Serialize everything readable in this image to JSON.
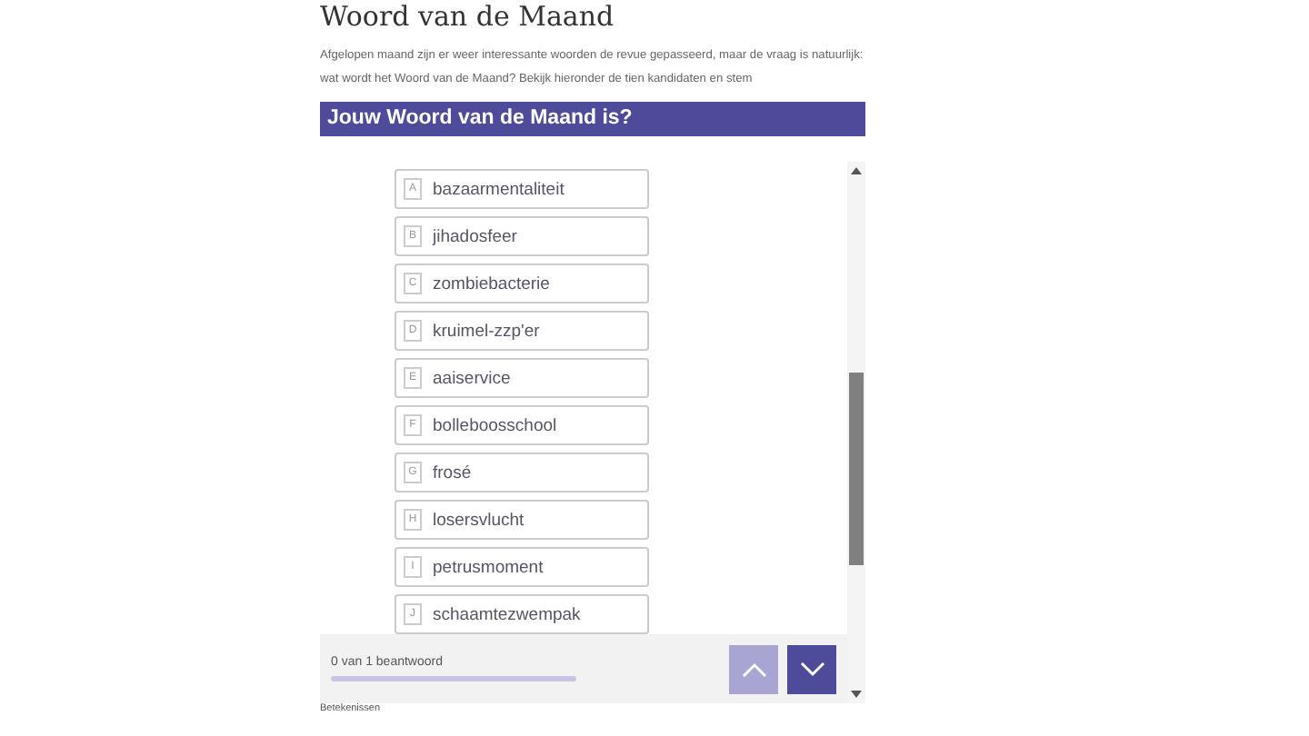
{
  "page": {
    "title": "Woord van de Maand",
    "intro": "Afgelopen maand zijn er weer interessante woorden de revue gepasseerd, maar de vraag is natuurlijk: wat wordt het Woord van de Maand? Bekijk hieronder de tien kandidaten en stem"
  },
  "survey": {
    "question": "Jouw Woord van de Maand is?",
    "options": [
      {
        "key": "A",
        "label": "bazaarmentaliteit",
        "selected": false
      },
      {
        "key": "B",
        "label": "jihadosfeer",
        "selected": false
      },
      {
        "key": "C",
        "label": "zombiebacterie",
        "selected": false
      },
      {
        "key": "D",
        "label": "kruimel-zzp'er",
        "selected": false
      },
      {
        "key": "E",
        "label": "aaiservice",
        "selected": false
      },
      {
        "key": "F",
        "label": "bolleboosschool",
        "selected": false
      },
      {
        "key": "G",
        "label": "frosé",
        "selected": false
      },
      {
        "key": "H",
        "label": "losersvlucht",
        "selected": false
      },
      {
        "key": "I",
        "label": "petrusmoment",
        "selected": false
      },
      {
        "key": "J",
        "label": "schaamtezwempak",
        "selected": false
      }
    ],
    "progress_text": "0 van 1 beantwoord",
    "progress": {
      "level": 0
    },
    "prev_disabled": true,
    "next_disabled": false
  },
  "footer_link": "Betekenissen"
}
